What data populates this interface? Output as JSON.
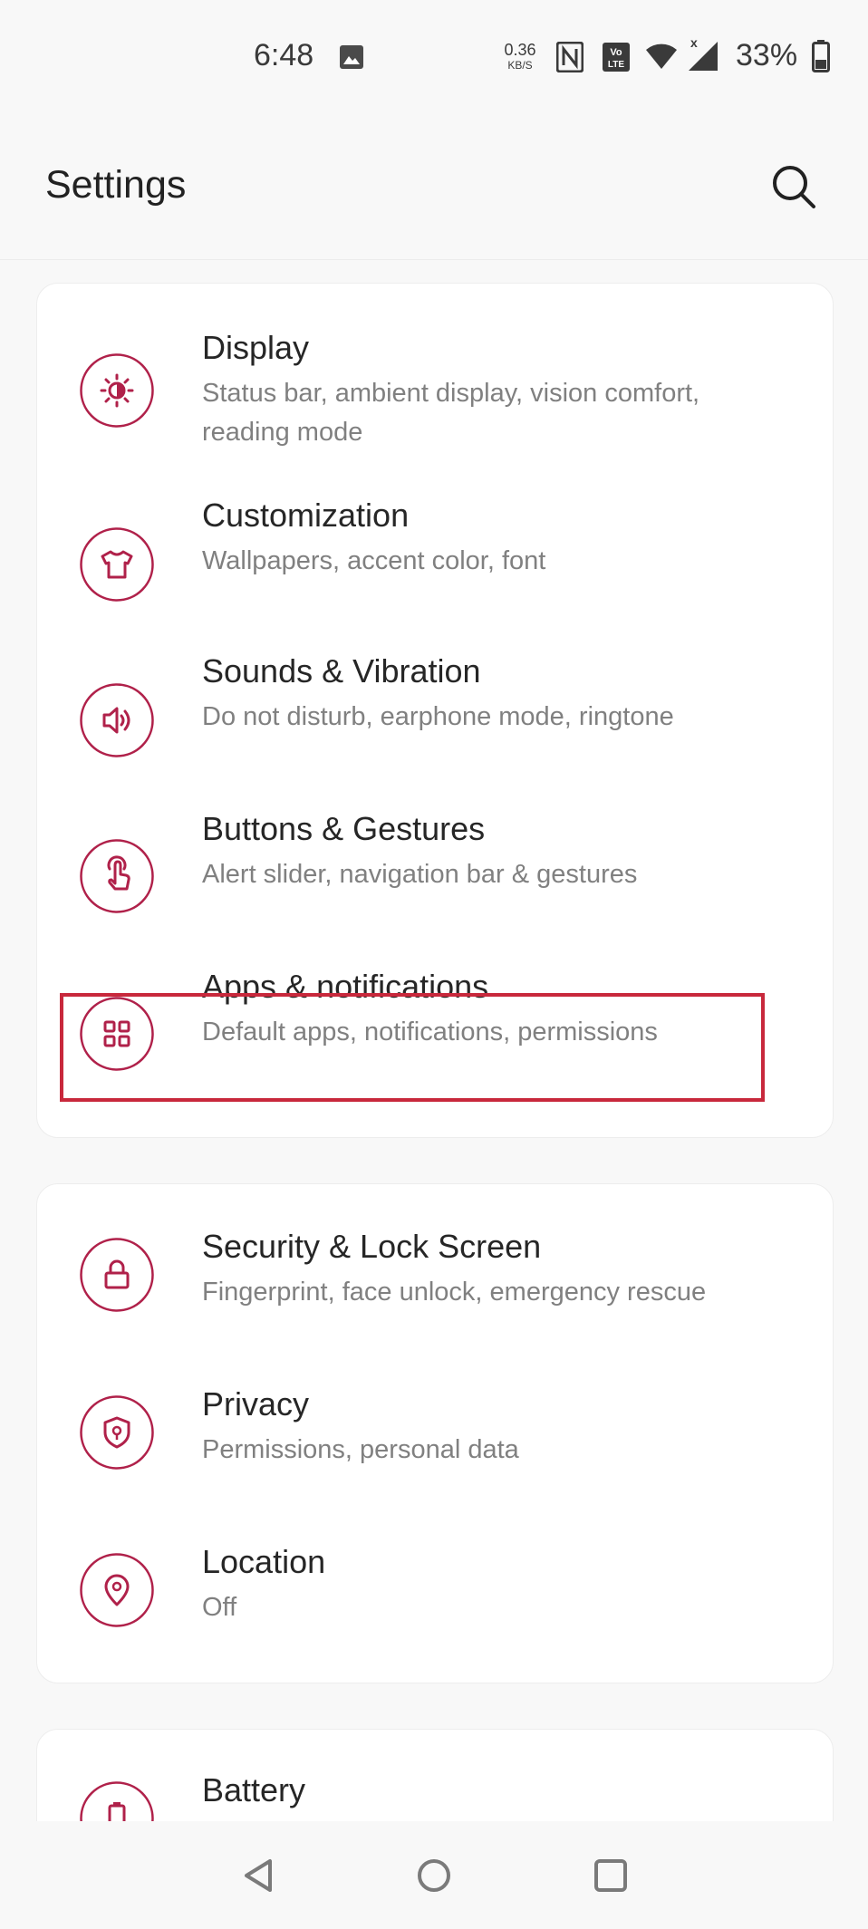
{
  "status_bar": {
    "time": "6:48",
    "net_speed_value": "0.36",
    "net_speed_unit": "KB/S",
    "battery_percent": "33%",
    "icons": [
      "gallery-icon",
      "nfc-icon",
      "volte-icon",
      "wifi-icon",
      "signal-icon",
      "battery-icon"
    ]
  },
  "header": {
    "title": "Settings",
    "search_icon": "search-icon"
  },
  "accent_color": "#b0214a",
  "highlight_color": "#c8283c",
  "groups": [
    {
      "items": [
        {
          "title": "Display",
          "subtitle": "Status bar, ambient display, vision comfort, reading mode",
          "icon": "brightness-icon"
        },
        {
          "title": "Customization",
          "subtitle": "Wallpapers, accent color, font",
          "icon": "tshirt-icon"
        },
        {
          "title": "Sounds & Vibration",
          "subtitle": "Do not disturb, earphone mode, ringtone",
          "icon": "speaker-icon"
        },
        {
          "title": "Buttons & Gestures",
          "subtitle": "Alert slider, navigation bar & gestures",
          "icon": "gesture-hand-icon"
        },
        {
          "title": "Apps & notifications",
          "subtitle": "Default apps, notifications, permissions",
          "icon": "apps-grid-icon"
        }
      ]
    },
    {
      "items": [
        {
          "title": "Security & Lock Screen",
          "subtitle": "Fingerprint, face unlock, emergency rescue",
          "icon": "lock-icon"
        },
        {
          "title": "Privacy",
          "subtitle": "Permissions, personal data",
          "icon": "privacy-shield-icon"
        },
        {
          "title": "Location",
          "subtitle": "Off",
          "icon": "location-pin-icon"
        }
      ]
    },
    {
      "items": [
        {
          "title": "Battery",
          "icon": "battery-icon"
        }
      ]
    }
  ],
  "nav_bar": {
    "buttons": [
      "back-icon",
      "home-icon",
      "recents-icon"
    ]
  }
}
